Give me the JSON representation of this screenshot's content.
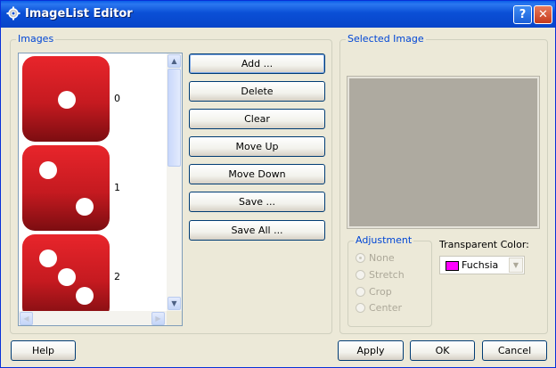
{
  "window": {
    "title": "ImageList Editor",
    "help_glyph": "?",
    "close_glyph": "✕"
  },
  "images_group": {
    "label": "Images",
    "items": [
      {
        "label": "0",
        "pips": 1
      },
      {
        "label": "1",
        "pips": 2
      },
      {
        "label": "2",
        "pips": 3
      }
    ]
  },
  "buttons": {
    "add": "Add ...",
    "delete": "Delete",
    "clear": "Clear",
    "move_up": "Move Up",
    "move_down": "Move Down",
    "save": "Save ...",
    "save_all": "Save All ..."
  },
  "selected_image": {
    "label": "Selected Image"
  },
  "adjustment": {
    "label": "Adjustment",
    "options": [
      "None",
      "Stretch",
      "Crop",
      "Center"
    ],
    "selected": "None"
  },
  "transparent_color": {
    "label": "Transparent Color:",
    "value": "Fuchsia",
    "swatch": "#ff00ff"
  },
  "footer": {
    "help": "Help",
    "apply": "Apply",
    "ok": "OK",
    "cancel": "Cancel"
  },
  "colors": {
    "titlebar": "#0a4fd6",
    "dialog_bg": "#ece9d8",
    "group_label": "#0046d5",
    "die_top": "#e8252b",
    "die_bottom": "#7c0d11"
  }
}
